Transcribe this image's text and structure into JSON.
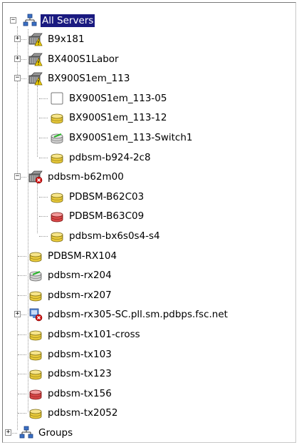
{
  "tree": {
    "root": {
      "label": "All Servers",
      "icon": "network-group-icon",
      "expanded": true
    },
    "nodes": [
      {
        "label": "B9x181",
        "icon": "server-rack-warning-icon",
        "expander": "+"
      },
      {
        "label": "BX400S1Labor",
        "icon": "server-rack-warning-icon",
        "expander": "+"
      },
      {
        "label": "BX900S1em_113",
        "icon": "server-rack-warning-icon",
        "expander": "-"
      },
      {
        "label": "BX900S1em_113-05",
        "icon": "blank-node-icon"
      },
      {
        "label": "BX900S1em_113-12",
        "icon": "server-yellow-icon"
      },
      {
        "label": "BX900S1em_113-Switch1",
        "icon": "switch-ok-icon"
      },
      {
        "label": "pdbsm-b924-2c8",
        "icon": "server-yellow-icon"
      },
      {
        "label": "pdbsm-b62m00",
        "icon": "server-rack-error-icon",
        "expander": "-"
      },
      {
        "label": "PDBSM-B62C03",
        "icon": "server-yellow-icon"
      },
      {
        "label": "PDBSM-B63C09",
        "icon": "server-red-icon"
      },
      {
        "label": "pdbsm-bx6s0s4-s4",
        "icon": "server-yellow-icon"
      },
      {
        "label": "PDBSM-RX104",
        "icon": "server-yellow-icon"
      },
      {
        "label": "pdbsm-rx204",
        "icon": "switch-ok-icon"
      },
      {
        "label": "pdbsm-rx207",
        "icon": "server-yellow-icon"
      },
      {
        "label": "pdbsm-rx305-SC.pll.sm.pdbps.fsc.net",
        "icon": "virtual-host-error-icon",
        "expander": "+"
      },
      {
        "label": "pdbsm-tx101-cross",
        "icon": "server-yellow-icon"
      },
      {
        "label": "pdbsm-tx103",
        "icon": "server-yellow-icon"
      },
      {
        "label": "pdbsm-tx123",
        "icon": "server-yellow-icon"
      },
      {
        "label": "pdbsm-tx156",
        "icon": "server-red-icon"
      },
      {
        "label": "pdbsm-tx2052",
        "icon": "server-yellow-icon"
      }
    ],
    "groups": {
      "label": "Groups",
      "icon": "network-group-icon",
      "expander": "+"
    }
  },
  "colors": {
    "selection": "#1a1a80",
    "status_warning": "#f0d000",
    "status_error": "#d01010",
    "status_ok": "#2bb52b"
  }
}
